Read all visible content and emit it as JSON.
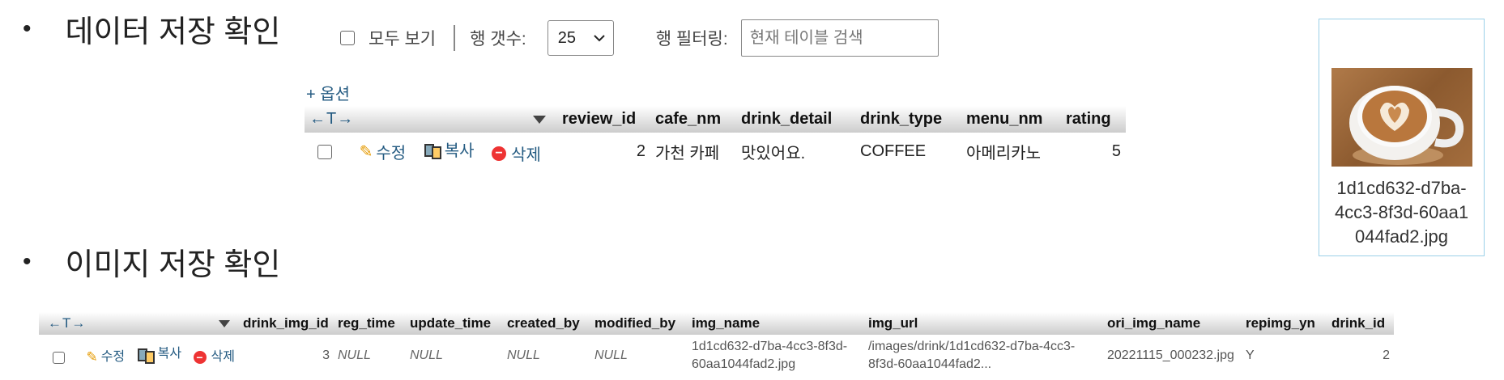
{
  "section1": {
    "bullet": "•",
    "title": "데이터 저장 확인"
  },
  "section2": {
    "bullet": "•",
    "title": "이미지 저장 확인"
  },
  "toolbar": {
    "show_all_label": "모두 보기",
    "row_count_label": "행 갯수:",
    "row_count_value": "25",
    "row_filter_label": "행 필터링:",
    "filter_placeholder": "현재 테이블 검색"
  },
  "options_link": "+ 옵션",
  "review_table": {
    "arrows": "←T→",
    "headers": [
      "review_id",
      "cafe_nm",
      "drink_detail",
      "drink_type",
      "menu_nm",
      "rating"
    ],
    "actions": {
      "edit": "수정",
      "copy": "복사",
      "delete": "삭제"
    },
    "rows": [
      {
        "review_id": "2",
        "cafe_nm": "가천 카페",
        "drink_detail": "맛있어요.",
        "drink_type": "COFFEE",
        "menu_nm": "아메리카노",
        "rating": "5"
      }
    ]
  },
  "image_table": {
    "arrows": "←T→",
    "headers": [
      "drink_img_id",
      "reg_time",
      "update_time",
      "created_by",
      "modified_by",
      "img_name",
      "img_url",
      "ori_img_name",
      "repimg_yn",
      "drink_id"
    ],
    "actions": {
      "edit": "수정",
      "copy": "복사",
      "delete": "삭제"
    },
    "rows": [
      {
        "drink_img_id": "3",
        "reg_time": "NULL",
        "update_time": "NULL",
        "created_by": "NULL",
        "modified_by": "NULL",
        "img_name_line1": "1d1cd632-d7ba-4cc3-8f3d-",
        "img_name_line2": "60aa1044fad2.jpg",
        "img_url_line1": "/images/drink/1d1cd632-d7ba-4cc3-",
        "img_url_line2": "8f3d-60aa1044fad2...",
        "ori_img_name": "20221115_000232.jpg",
        "repimg_yn": "Y",
        "drink_id": "2"
      }
    ]
  },
  "image_preview": {
    "caption_lines": [
      "1d1cd632-d7ba-",
      "4cc3-8f3d-60aa1",
      "044fad2.jpg"
    ]
  },
  "colors": {
    "link": "#235a81",
    "header_gradient_top": "#ffffff",
    "header_gradient_bottom": "#cccccc",
    "card_border": "#9bd0e8"
  }
}
